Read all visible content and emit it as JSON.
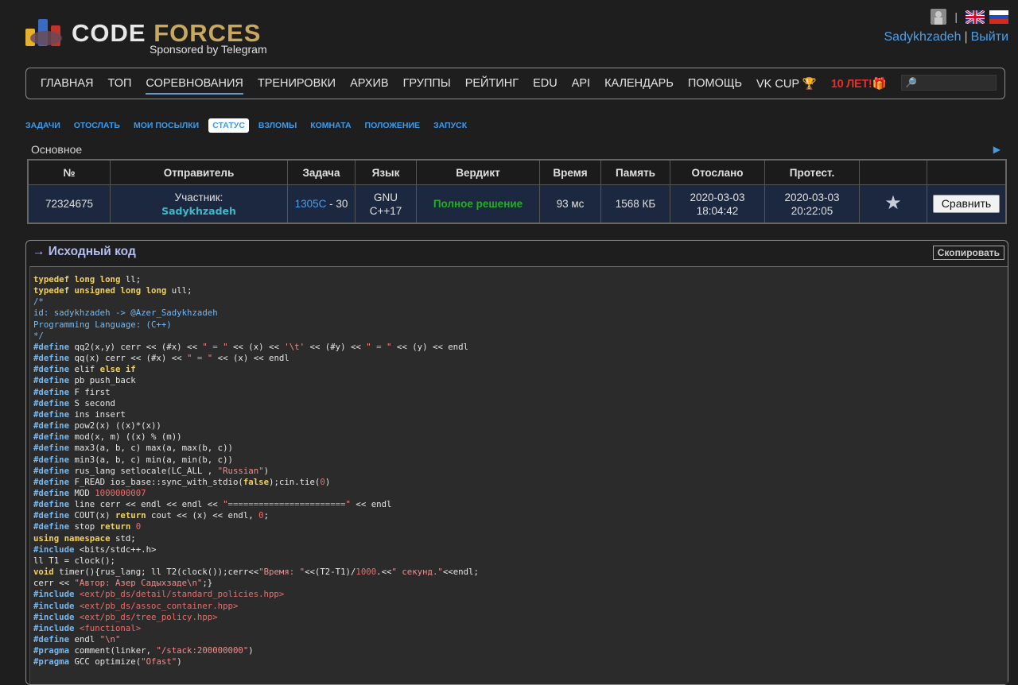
{
  "header": {
    "logo_code": "CODE",
    "logo_forces": "FORCES",
    "sponsor": "Sponsored by Telegram",
    "separator": "|",
    "username": "Sadykhzadeh",
    "logout": "Выйти"
  },
  "mainnav": {
    "items": [
      "ГЛАВНАЯ",
      "ТОП",
      "СОРЕВНОВАНИЯ",
      "ТРЕНИРОВКИ",
      "АРХИВ",
      "ГРУППЫ",
      "РЕЙТИНГ",
      "EDU",
      "API",
      "КАЛЕНДАРЬ",
      "ПОМОЩЬ",
      "VK CUP"
    ],
    "special": "10 ЛЕТ!"
  },
  "subnav": {
    "items": [
      "ЗАДАЧИ",
      "ОТОСЛАТЬ",
      "МОИ ПОСЫЛКИ",
      "СТАТУС",
      "ВЗЛОМЫ",
      "КОМНАТА",
      "ПОЛОЖЕНИЕ",
      "ЗАПУСК"
    ]
  },
  "status": {
    "section_title": "Основное",
    "headers": [
      "№",
      "Отправитель",
      "Задача",
      "Язык",
      "Вердикт",
      "Время",
      "Память",
      "Отослано",
      "Протест.",
      "",
      ""
    ],
    "row": {
      "id": "72324675",
      "sender_role": "Участник:",
      "sender_handle": "Sadykhzadeh",
      "problem_link": "1305C",
      "problem_suffix": " - 30",
      "lang_1": "GNU",
      "lang_2": "C++17",
      "verdict": "Полное решение",
      "time": "93 мс",
      "memory": "1568 КБ",
      "sent_date": "2020-03-03",
      "sent_time": "18:04:42",
      "judged_date": "2020-03-03",
      "judged_time": "20:22:05",
      "compare_label": "Сравнить"
    }
  },
  "source": {
    "title": "→ Исходный код",
    "copy_label": "Скопировать",
    "lines": [
      "typedef long long ll;",
      "typedef unsigned long long ull;",
      "/*",
      "id: sadykhzadeh -> @Azer_Sadykhzadeh",
      "Programming Language: (C++)",
      "*/",
      "#define qq2(x,y) cerr << (#x) << \" = \" << (x) << '\\t' << (#y) << \" = \" << (y) << endl",
      "#define qq(x) cerr << (#x) << \" = \" << (x) << endl",
      "#define elif else if",
      "#define pb push_back",
      "#define F first",
      "#define S second",
      "#define ins insert",
      "#define pow2(x) ((x)*(x))",
      "#define mod(x, m) ((x) % (m))",
      "#define max3(a, b, c) max(a, max(b, c))",
      "#define min3(a, b, c) min(a, min(b, c))",
      "#define rus_lang setlocale(LC_ALL , \"Russian\")",
      "#define F_READ ios_base::sync_with_stdio(false);cin.tie(0)",
      "#define MOD 1000000007",
      "#define line cerr << endl << endl << \"=======================\" << endl",
      "#define COUT(x) return cout << (x) << endl, 0;",
      "#define stop return 0",
      "using namespace std;",
      "#include <bits/stdc++.h>",
      "ll T1 = clock();",
      "void timer(){rus_lang; ll T2(clock());cerr<<\"Время: \"<<(T2-T1)/1000.<<\" секунд.\"<<endl;",
      "cerr << \"Автор: Азер Садыхзаде\\n\";}",
      "#include <ext/pb_ds/detail/standard_policies.hpp>",
      "#include <ext/pb_ds/assoc_container.hpp>",
      "#include <ext/pb_ds/tree_policy.hpp>",
      "#include <functional>",
      "#define endl \"\\n\"",
      "#pragma comment(linker, \"/stack:200000000\")",
      "#pragma GCC optimize(\"Ofast\")"
    ]
  }
}
